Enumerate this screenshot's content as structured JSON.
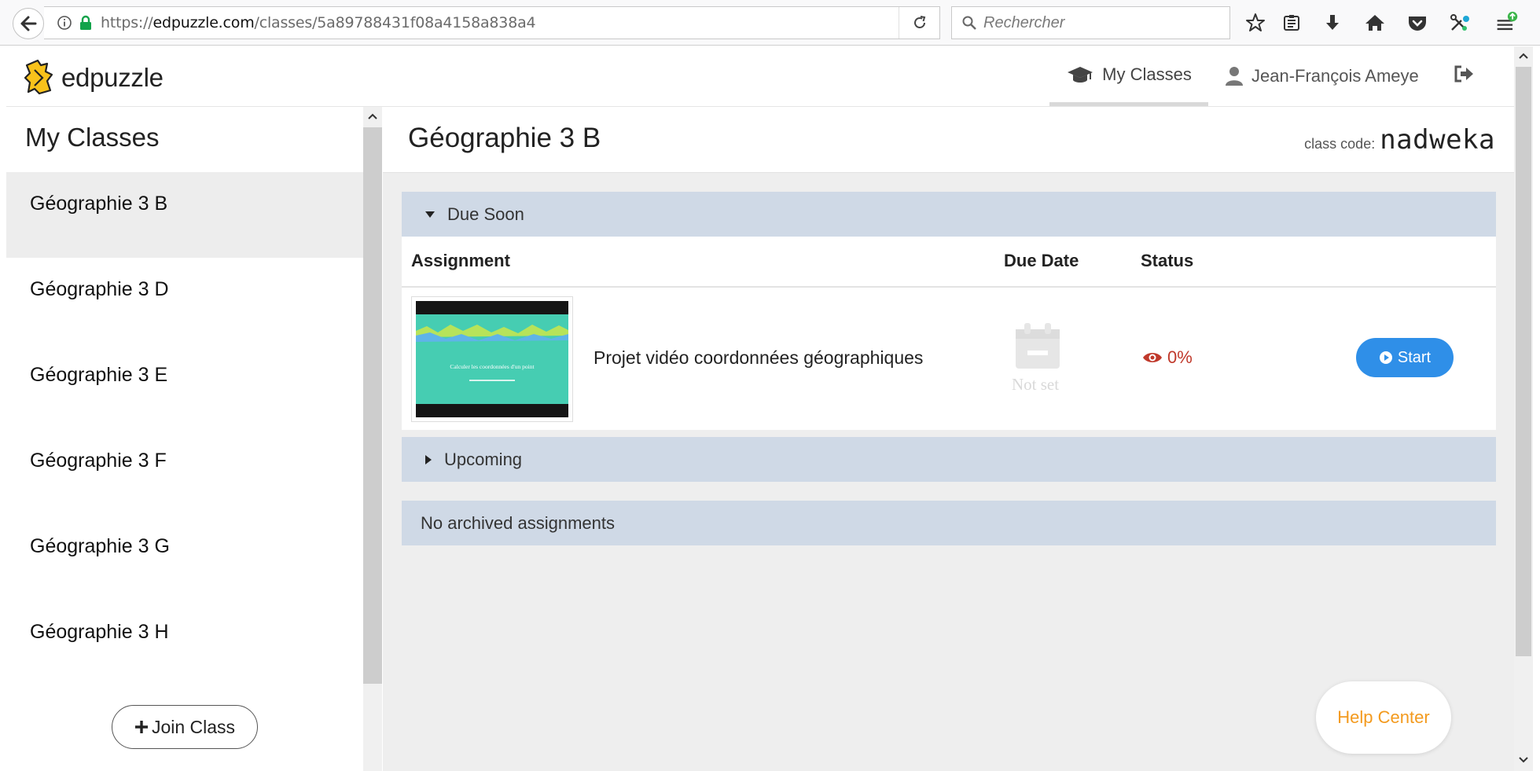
{
  "browser": {
    "url_prefix": "https://",
    "url_host": "edpuzzle.com",
    "url_path": "/classes/5a89788431f08a4158a838a4",
    "search_placeholder": "Rechercher"
  },
  "header": {
    "logo_text": "edpuzzle",
    "nav_my_classes": "My Classes",
    "nav_user": "Jean-François Ameye"
  },
  "sidebar": {
    "title": "My Classes",
    "classes": [
      {
        "label": "Géographie 3 B"
      },
      {
        "label": "Géographie 3 D"
      },
      {
        "label": "Géographie 3 E"
      },
      {
        "label": "Géographie 3 F"
      },
      {
        "label": "Géographie 3 G"
      },
      {
        "label": "Géographie 3 H"
      }
    ],
    "join_label": "Join Class"
  },
  "main": {
    "class_title": "Géographie 3 B",
    "class_code_label": "class code:",
    "class_code": "nadweka",
    "due_soon_label": "Due Soon",
    "columns": {
      "assignment": "Assignment",
      "due_date": "Due Date",
      "status": "Status"
    },
    "assignment": {
      "title": "Projet vidéo coordonnées géographiques",
      "thumb_caption": "Calculer les coordonnées d'un point",
      "due": "Not set",
      "progress": "0%",
      "start_label": "Start"
    },
    "upcoming_label": "Upcoming",
    "archived_label": "No archived assignments",
    "help_label": "Help Center"
  },
  "colors": {
    "accent": "#2f8fe8",
    "section_bar": "#cfd9e6",
    "help": "#f39a1e",
    "status": "#c0392b"
  }
}
